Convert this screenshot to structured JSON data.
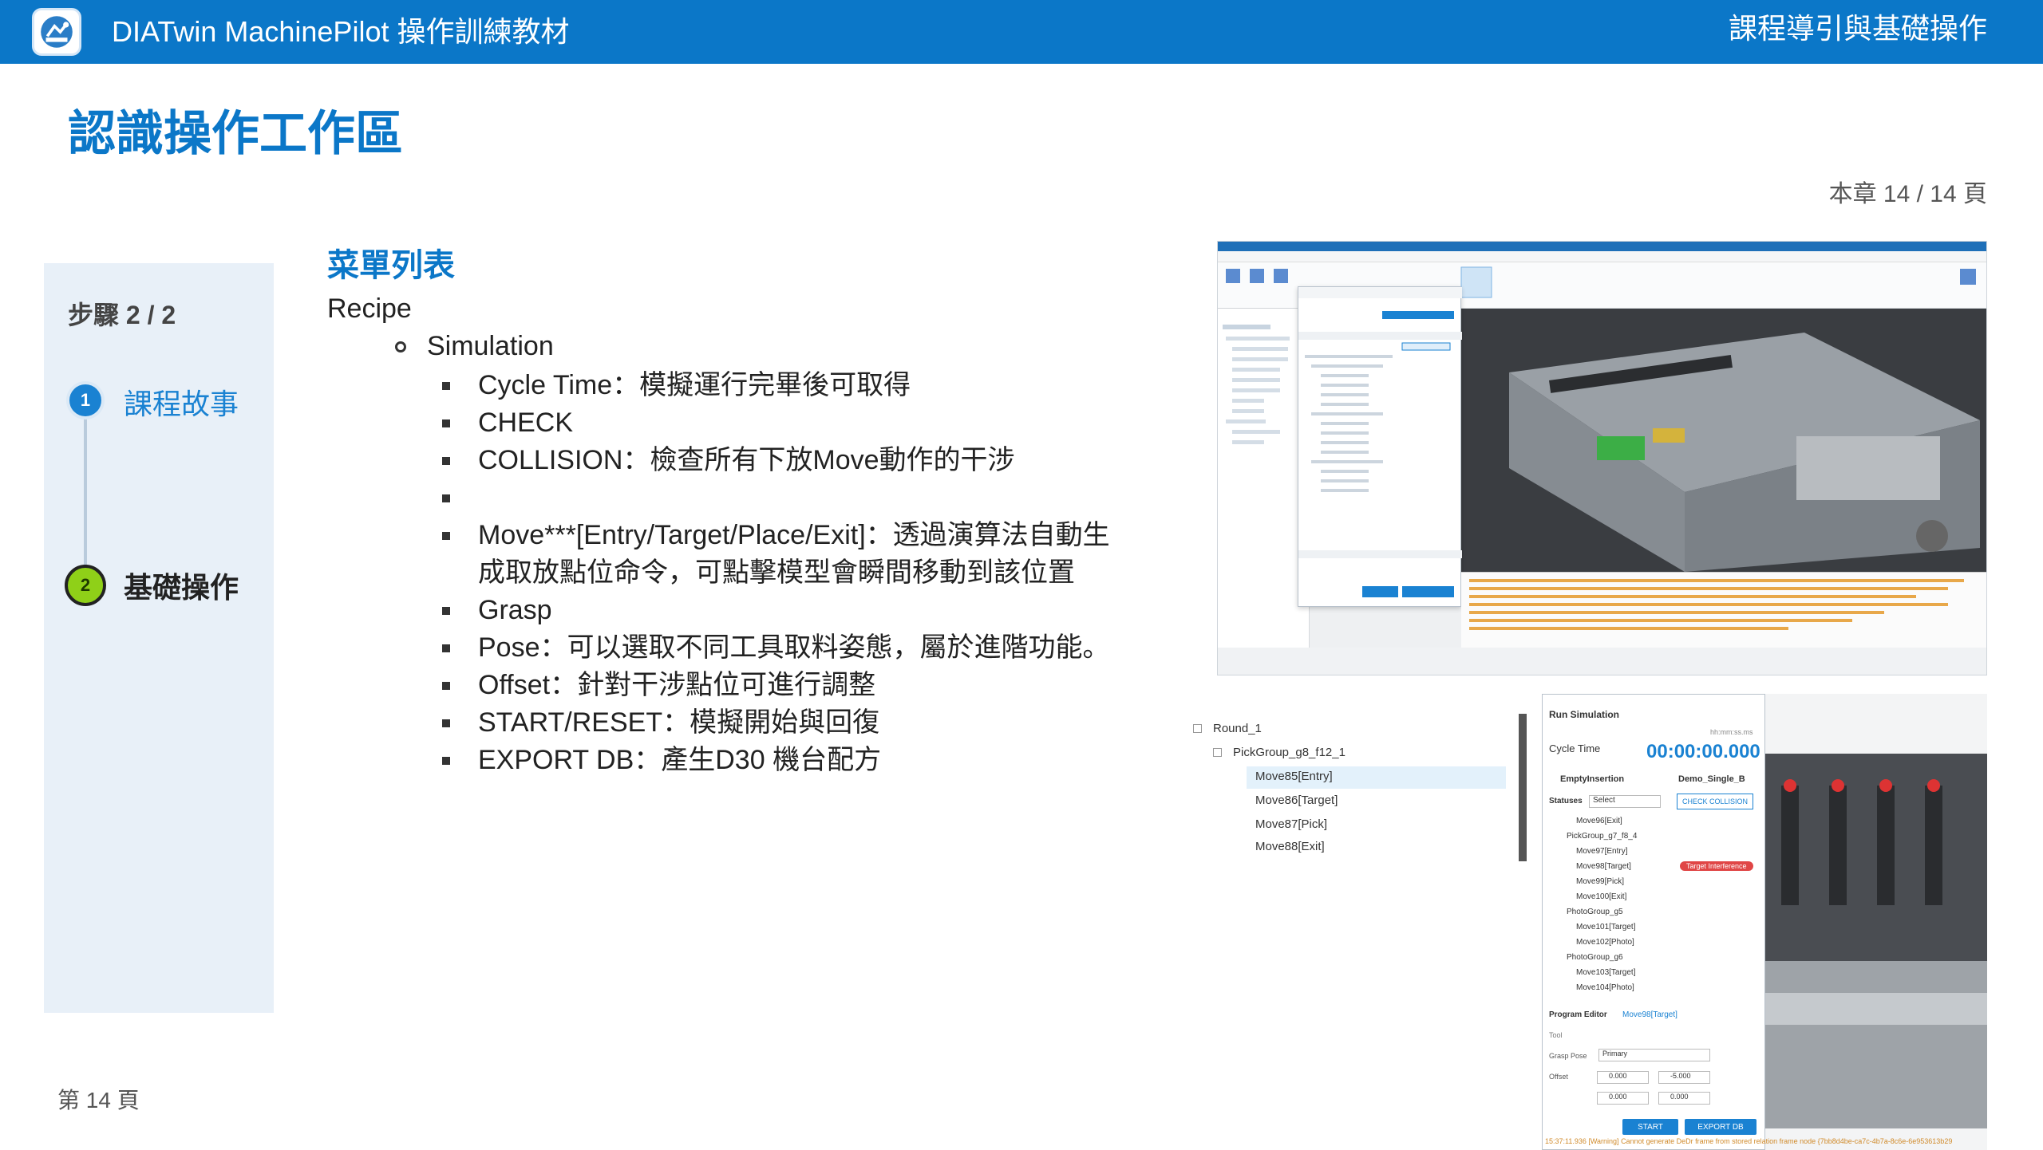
{
  "header": {
    "app_title": "DIATwin MachinePilot 操作訓練教材",
    "section_title": "課程導引與基礎操作"
  },
  "page": {
    "title": "認識操作工作區",
    "chapter_page": "本章 14 / 14 頁",
    "footer": "第 14 頁"
  },
  "sidebar": {
    "step_label": "步驟 2 / 2",
    "steps": [
      {
        "number": "1",
        "label": "課程故事"
      },
      {
        "number": "2",
        "label": "基礎操作"
      }
    ]
  },
  "content": {
    "heading": "菜單列表",
    "level0": "Recipe",
    "level1": "Simulation",
    "bullets": [
      "Cycle Time：模擬運行完畢後可取得",
      "CHECK",
      "COLLISION：檢查所有下放Move動作的干涉",
      "",
      "Move***[Entry/Target/Place/Exit]：透過演算法自動生成取放點位命令，可點擊模型會瞬間移動到該位置",
      "Grasp",
      "Pose：可以選取不同工具取料姿態，屬於進階功能。",
      "Offset：針對干涉點位可進行調整",
      "START/RESET：模擬開始與回復",
      "EXPORT  DB：產生D30 機台配方"
    ]
  },
  "screenshot_tree": {
    "rows": [
      "Round_1",
      "PickGroup_g8_f12_1",
      "Move85[Entry]",
      "Move86[Target]",
      "Move87[Pick]",
      "Move88[Exit]"
    ]
  },
  "screenshot_panel": {
    "title": "Run Simulation",
    "cycle_label": "Cycle Time",
    "cycle_value": "00:00:00.000",
    "hint": "hh:mm:ss.ms",
    "insertion": "EmptyInsertion",
    "board": "Demo_Single_B",
    "statuses": "Statuses",
    "select": "Select",
    "check_collision": "CHECK COLLISION",
    "list": [
      "Move96[Exit]",
      "PickGroup_g7_f8_4",
      "Move97[Entry]",
      "Move98[Target]",
      "Move99[Pick]",
      "Move100[Exit]",
      "PhotoGroup_g5",
      "Move101[Target]",
      "Move102[Photo]",
      "PhotoGroup_g6",
      "Move103[Target]",
      "Move104[Photo]"
    ],
    "interference": "Target Interference",
    "program_editor": "Program Editor",
    "program_target": "Move98[Target]",
    "tool": "Tool",
    "grasp_pose": "Grasp Pose",
    "grasp_value": "Primary",
    "offset": "Offset",
    "offset_x": "0.000",
    "offset_y": "-5.000",
    "offset_z": "0.000",
    "offset_r": "0.000",
    "start": "START",
    "export": "EXPORT DB",
    "log": "15:37:11.936 [Warning] Cannot generate DeDr frame from stored relation frame node {7bb8d4be-ca7c-4b7a-8c6e-6e953613b29"
  }
}
